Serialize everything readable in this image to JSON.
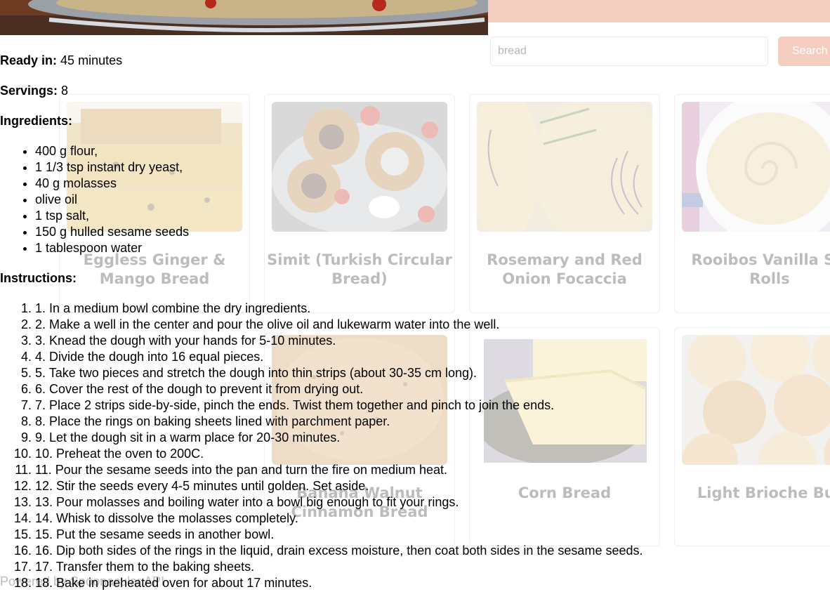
{
  "search": {
    "value": "bread",
    "button_label": "Search"
  },
  "cards": [
    {
      "title": "Eggless Ginger & Mango Bread",
      "image": "bread-loaf-slices"
    },
    {
      "title": "Simit (Turkish Circular Bread)",
      "image": "simit-rings"
    },
    {
      "title": "Rosemary and Red Onion Focaccia",
      "image": "focaccia"
    },
    {
      "title": "Rooibos Vanilla Sw Rolls",
      "image": "swirl-roll"
    },
    {
      "title": "Banana Walnut Cinnamon Bread",
      "image": "banana-bread"
    },
    {
      "title": "Corn Bread",
      "image": "corn-bread"
    },
    {
      "title": "Light Brioche Bur",
      "image": "brioche-buns"
    }
  ],
  "footer": {
    "text": "Powered by Spoonacular API"
  },
  "recipe": {
    "ready_label": "Ready in:",
    "ready_value": "45 minutes",
    "servings_label": "Servings:",
    "servings_value": "8",
    "ingredients_label": "Ingredients:",
    "ingredients": [
      "400 g flour,",
      "1 1/3 tsp instant dry yeast,",
      "40 g molasses",
      "olive oil",
      "1 tsp salt,",
      "150 g hulled sesame seeds",
      "1 tablespoon water"
    ],
    "instructions_label": "Instructions:",
    "instructions": [
      "1. In a medium bowl combine the dry ingredients.",
      "2. Make a well in the center and pour the olive oil and lukewarm water into the well.",
      "3. Knead the dough with your hands for 5-10 minutes.",
      "4. Divide the dough into 16 equal pieces.",
      "5. Take two pieces and stretch the dough into thin strips (about 30-35 cm long).",
      "6. Cover the rest of the dough to prevent it from drying out.",
      "7. Place 2 strips side-by-side, pinch the ends. Twist them together and pinch to join the ends.",
      "8. Place the rings on baking sheets lined with parchment paper.",
      "9. Let the dough sit in a warm place for 20-30 minutes.",
      "10. Preheat the oven to 200C.",
      "11. Pour the sesame seeds into the pan and turn the fire on medium heat.",
      "12. Stir the seeds every 4-5 minutes until golden. Set aside.",
      "13. Pour molasses and boiling water into a bowl big enough to fit your rings.",
      "14. Whisk to dissolve the molasses completely.",
      "15. Put the sesame seeds in another bowl.",
      "16. Dip both sides of the rings in the liquid, drain excess moisture, then coat both sides in the sesame seeds.",
      "17. Transfer them to the baking sheets.",
      "18. Bake in preheated oven for about 17 minutes."
    ]
  },
  "colors": {
    "accent": "#e36a45"
  }
}
